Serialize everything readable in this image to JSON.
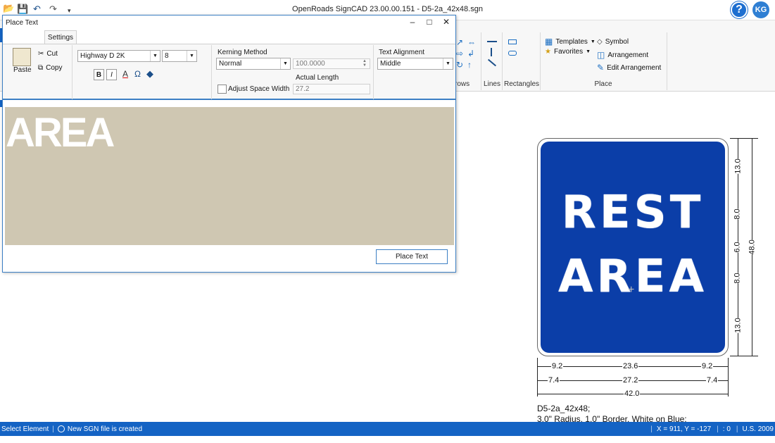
{
  "app": {
    "title": "OpenRoads SignCAD 23.00.00.151 - D5-2a_42x48.sgn",
    "user_initials": "KG",
    "help_label": "?"
  },
  "ribbon": {
    "groups": {
      "arrows": "rows",
      "lines": "Lines",
      "rectangles": "Rectangles",
      "place": "Place"
    },
    "place_items": {
      "templates": "Templates",
      "favorites": "Favorites",
      "symbol": "Symbol",
      "arrangement": "Arrangement",
      "edit_arrangement": "Edit Arrangement"
    }
  },
  "dialog": {
    "title": "Place Text",
    "tab": "Settings",
    "clipboard": {
      "paste": "Paste",
      "cut": "Cut",
      "copy": "Copy"
    },
    "font": {
      "name": "Highway D 2K",
      "size": "8"
    },
    "format": {
      "bold": "B",
      "italic": "I",
      "color_glyph": "A",
      "symbol_glyph": "Ω"
    },
    "kerning": {
      "label": "Kerning Method",
      "value": "Normal",
      "percent": "100.0000",
      "actual_length_label": "Actual Length",
      "actual_length": "27.2",
      "adjust_space_label": "Adjust Space Width"
    },
    "alignment": {
      "label": "Text Alignment",
      "value": "Middle"
    },
    "preview_text": "AREA",
    "place_button": "Place Text"
  },
  "sign": {
    "lines": [
      "REST",
      "AREA"
    ],
    "colors": {
      "background": "#0b3ea8",
      "text": "#ffffff"
    },
    "vertical_dims": [
      "13.0",
      "8.0",
      "6.0",
      "8.0",
      "13.0"
    ],
    "total_height": "48.0",
    "row1_dims": [
      "9.2",
      "23.6",
      "9.2"
    ],
    "row2_dims": [
      "7.4",
      "27.2",
      "7.4"
    ],
    "total_width": "42.0",
    "caption": [
      "D5-2a_42x48;",
      "3.0\" Radius, 1.0\" Border, White on Blue;"
    ]
  },
  "status": {
    "command": "Select Element",
    "message": "New SGN file is created",
    "coords": "X = 911, Y = -127",
    "lock": ": 0",
    "units": "U.S. 2009"
  }
}
